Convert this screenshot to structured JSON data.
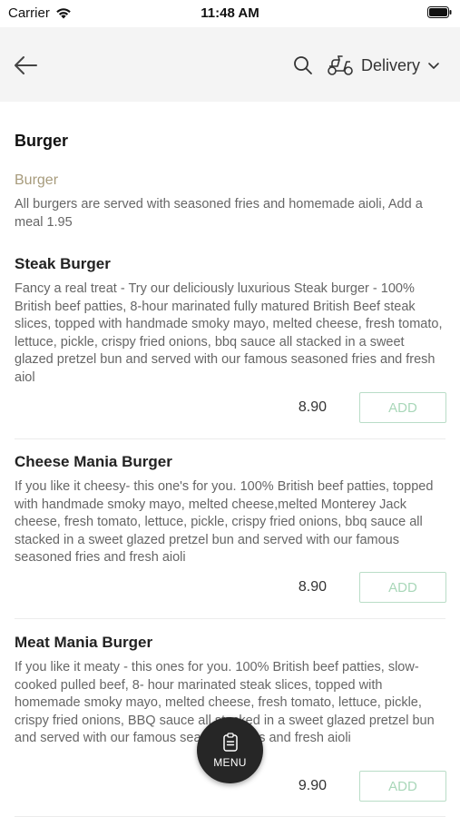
{
  "status_bar": {
    "carrier": "Carrier",
    "time": "11:48 AM"
  },
  "header": {
    "delivery_label": "Delivery"
  },
  "section": {
    "title": "Burger",
    "category_name": "Burger",
    "category_description": "All burgers are served with seasoned fries and homemade aioli, Add a meal 1.95"
  },
  "items": [
    {
      "name": "Steak Burger",
      "description": "Fancy a real treat - Try our deliciously luxurious Steak burger - 100% British beef patties, 8-hour marinated fully matured British Beef steak slices, topped with handmade smoky mayo, melted cheese, fresh tomato, lettuce, pickle, crispy fried onions, bbq sauce all stacked in a sweet glazed pretzel bun and served with our famous seasoned fries and fresh aiol",
      "price": "8.90",
      "add_label": "ADD"
    },
    {
      "name": "Cheese Mania Burger",
      "description": "If you like it cheesy- this one's for you. 100% British beef patties, topped with handmade smoky mayo, melted cheese,melted Monterey Jack cheese, fresh tomato, lettuce, pickle, crispy fried onions, bbq sauce all stacked in a sweet glazed pretzel bun and served with our famous seasoned fries and fresh aioli",
      "price": "8.90",
      "add_label": "ADD"
    },
    {
      "name": "Meat Mania Burger",
      "description": "If you like it meaty - this ones for you. 100% British beef patties, slow-cooked pulled beef, 8- hour marinated steak slices, topped with homemade smoky mayo, melted cheese, fresh tomato, lettuce, pickle, crispy fried onions, BBQ sauce all stacked in a sweet glazed pretzel bun and served with our famous seasoned fries and fresh aioli",
      "price": "9.90",
      "add_label": "ADD"
    }
  ],
  "fab": {
    "label": "MENU"
  },
  "colors": {
    "header_bg": "#f4f4f4",
    "category_name": "#a79b7c",
    "add_button_border": "#b9ddc7",
    "add_button_text": "#a9d7b9",
    "fab_bg": "#262626"
  }
}
